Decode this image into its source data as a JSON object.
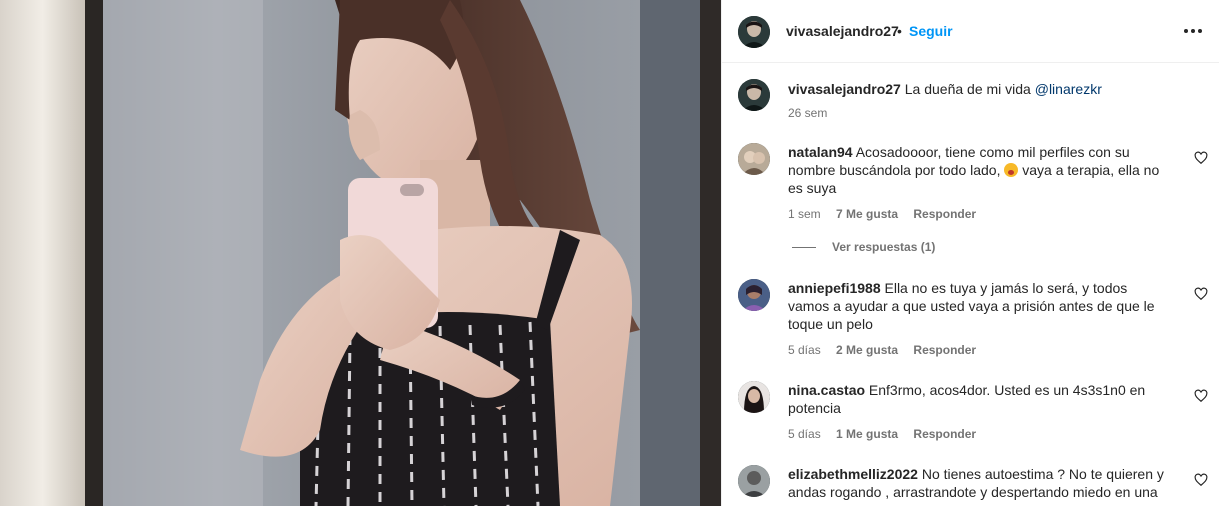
{
  "post": {
    "username": "vivasalejandro27",
    "dot": "•",
    "follow_label": "Seguir",
    "more_icon": "more-horizontal-icon"
  },
  "caption": {
    "username": "vivasalejandro27",
    "text": "La dueña de mi vida",
    "mention": "@linarezkr",
    "time": "26 sem"
  },
  "comments": [
    {
      "username": "natalan94",
      "text_before": "Acosadoooor, tiene como mil perfiles con su nombre buscándola por todo lado,",
      "emoji": "face-screaming-emoji",
      "text_after": "vaya a terapia, ella no es suya",
      "time": "1 sem",
      "likes": "7 Me gusta",
      "reply": "Responder",
      "view_replies": "Ver respuestas (1)"
    },
    {
      "username": "anniepefi1988",
      "text": "Ella no es tuya y jamás lo será, y todos vamos a ayudar a que usted vaya a prisión antes de que le toque un pelo",
      "time": "5 días",
      "likes": "2 Me gusta",
      "reply": "Responder"
    },
    {
      "username": "nina.castao",
      "text": "Enf3rmo, acos4dor. Usted es un 4s3s1n0 en potencia",
      "time": "5 días",
      "likes": "1 Me gusta",
      "reply": "Responder"
    },
    {
      "username": "elizabethmelliz2022",
      "text": "No tienes autoestima ? No te quieren y andas rogando , arrastrandote y despertando miedo en una"
    }
  ],
  "colors": {
    "follow": "#0095f6",
    "mention": "#00376b",
    "muted": "#737373",
    "text": "#262626"
  }
}
